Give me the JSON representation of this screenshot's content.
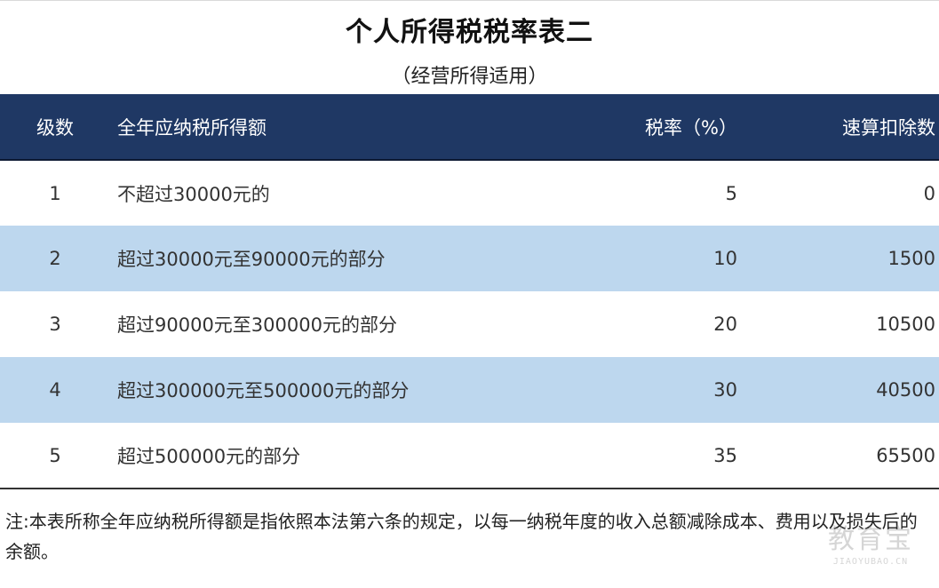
{
  "document": {
    "title": "个人所得税税率表二",
    "subtitle": "（经营所得适用）",
    "table": {
      "headers": {
        "level": "级数",
        "income": "全年应纳税所得额",
        "rate": "税率（%）",
        "deduction": "速算扣除数"
      },
      "rows": [
        {
          "level": "1",
          "income": "不超过30000元的",
          "rate": "5",
          "deduction": "0"
        },
        {
          "level": "2",
          "income": "超过30000元至90000元的部分",
          "rate": "10",
          "deduction": "1500"
        },
        {
          "level": "3",
          "income": "超过90000元至300000元的部分",
          "rate": "20",
          "deduction": "10500"
        },
        {
          "level": "4",
          "income": "超过300000元至500000元的部分",
          "rate": "30",
          "deduction": "40500"
        },
        {
          "level": "5",
          "income": "超过500000元的部分",
          "rate": "35",
          "deduction": "65500"
        }
      ],
      "colors": {
        "header_bg": "#1f3864",
        "shaded_row_bg": "#bdd7ee"
      }
    },
    "note": "注:本表所称全年应纳税所得额是指依照本法第六条的规定，以每一纳税年度的收入总额减除成本、费用以及损失后的余额。",
    "watermark": {
      "main": "教育宝",
      "sub": "JIAOYUBAO.CN"
    }
  }
}
